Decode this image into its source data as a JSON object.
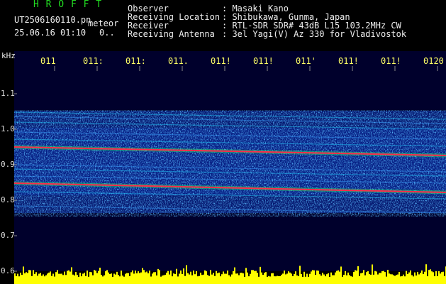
{
  "header": {
    "app_name": "H R O F F T",
    "filename": "UT2506160110.pn",
    "mode": "meteor",
    "datetime": "25.06.16 01:10",
    "counter": "0..",
    "info_labels": [
      "Observer",
      "Receiving Location",
      "Receiver",
      "Receiving Antenna"
    ],
    "info_values": [
      ": Masaki Kano",
      ": Shibukawa, Gunma, Japan",
      ": RTL-SDR SDR# 43dB L15 103.2MHz CW",
      ": 3el Yagi(V) Az 330 for Vladivostok"
    ]
  },
  "plot": {
    "y_unit": "kHz",
    "y_ticks": [
      "1.1",
      "1.0",
      "0.9",
      "0.8",
      "0.7",
      "0.6"
    ],
    "x_ticks": [
      "011",
      "011:",
      "011:",
      "011.",
      "011!",
      "011!",
      "011'",
      "011!",
      "011!",
      "0120"
    ],
    "colors": {
      "background": "#00002c",
      "signal": "#ff2a4c",
      "noise_bar": "#ffff00",
      "text": "#ffffff",
      "title": "#22dd22"
    }
  }
}
